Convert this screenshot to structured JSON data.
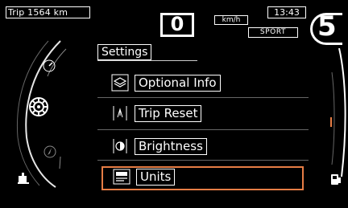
{
  "top": {
    "trip": "Trip 1564 km",
    "speed": "0",
    "unit": "km/h",
    "time": "13:43",
    "mode": "SPORT",
    "gear": "5"
  },
  "menu": {
    "title": "Settings",
    "items": [
      {
        "label": "Optional Info",
        "icon": "layers-icon"
      },
      {
        "label": "Trip Reset",
        "icon": "trip-reset-icon"
      },
      {
        "label": "Brightness",
        "icon": "brightness-icon"
      },
      {
        "label": "Units",
        "icon": "units-icon"
      }
    ],
    "selected_index": 3
  },
  "colors": {
    "background": "#000000",
    "foreground": "#ffffff",
    "highlight": "#e67d45"
  },
  "icons": {
    "left_panel": [
      "rpm-icon",
      "settings-icon",
      "navigation-icon",
      "oil-icon"
    ],
    "right_panel": [
      "fuel-icon"
    ]
  }
}
